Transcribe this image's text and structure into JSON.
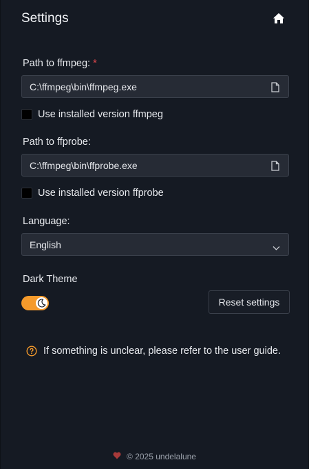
{
  "header": {
    "title": "Settings",
    "home_icon": "home-icon"
  },
  "ffmpeg": {
    "label": "Path to ffmpeg:",
    "required_mark": "*",
    "value": "C:\\ffmpeg\\bin\\ffmpeg.exe",
    "checkbox_label": "Use installed version ffmpeg",
    "checked": false
  },
  "ffprobe": {
    "label": "Path to ffprobe:",
    "value": "C:\\ffmpeg\\bin\\ffprobe.exe",
    "checkbox_label": "Use installed version ffprobe",
    "checked": false
  },
  "language": {
    "label": "Language:",
    "selected": "English"
  },
  "theme": {
    "label": "Dark Theme",
    "enabled": true
  },
  "reset_button": "Reset settings",
  "hint": {
    "icon": "help-circle-icon",
    "text": "If something is unclear, please refer to the user guide."
  },
  "footer": {
    "text": "© 2025 undelalune",
    "icon": "heart-icon"
  },
  "colors": {
    "accent": "#f59a2b",
    "required": "#e5484d",
    "background": "#151a23",
    "input_background": "#262b35"
  }
}
